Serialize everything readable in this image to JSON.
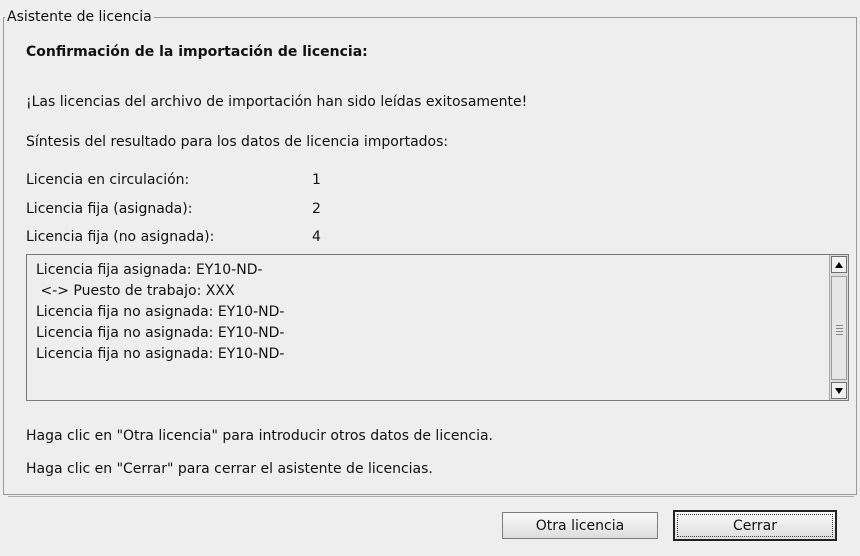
{
  "wizard": {
    "title": "Asistente de licencia",
    "heading": "Confirmación de la importación de licencia:",
    "success_message": "¡Las licencias del archivo de importación han sido leídas exitosamente!",
    "summary_intro": "Síntesis del resultado para los datos de licencia importados:",
    "stats": [
      {
        "label": "Licencia en circulación:",
        "value": "1"
      },
      {
        "label": "Licencia fija (asignada):",
        "value": "2"
      },
      {
        "label": "Licencia fija (no asignada):",
        "value": "4"
      }
    ],
    "details": [
      "Licencia fija asignada: EY10-ND-",
      " <-> Puesto de trabajo: XXX",
      "Licencia fija no asignada: EY10-ND-",
      "Licencia fija no asignada: EY10-ND-",
      "Licencia fija no asignada: EY10-ND-"
    ],
    "hint_other": "Haga clic en \"Otra licencia\" para introducir otros datos de licencia.",
    "hint_close": "Haga clic en \"Cerrar\" para cerrar el asistente de licencias."
  },
  "buttons": {
    "other_license": "Otra licencia",
    "close": "Cerrar"
  }
}
